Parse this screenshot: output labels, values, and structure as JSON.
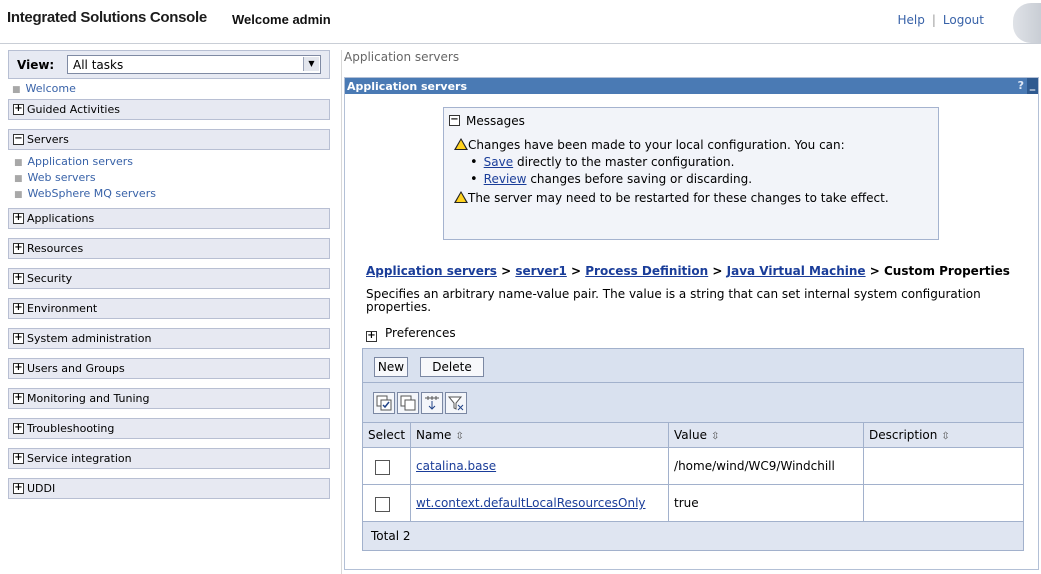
{
  "header": {
    "app_title": "Integrated Solutions Console",
    "welcome": "Welcome admin",
    "help": "Help",
    "logout": "Logout"
  },
  "nav": {
    "view_label": "View:",
    "view_value": "All tasks",
    "welcome": "Welcome",
    "groups": [
      {
        "label": "Guided Activities",
        "state": "+"
      },
      {
        "label": "Servers",
        "state": "−",
        "items": [
          "Application servers",
          "Web servers",
          "WebSphere MQ servers"
        ]
      },
      {
        "label": "Applications",
        "state": "+"
      },
      {
        "label": "Resources",
        "state": "+"
      },
      {
        "label": "Security",
        "state": "+"
      },
      {
        "label": "Environment",
        "state": "+"
      },
      {
        "label": "System administration",
        "state": "+"
      },
      {
        "label": "Users and Groups",
        "state": "+"
      },
      {
        "label": "Monitoring and Tuning",
        "state": "+"
      },
      {
        "label": "Troubleshooting",
        "state": "+"
      },
      {
        "label": "Service integration",
        "state": "+"
      },
      {
        "label": "UDDI",
        "state": "+"
      }
    ]
  },
  "main": {
    "page_heading": "Application servers",
    "panel_title": "Application servers",
    "panel_help": "?",
    "panel_minimize": "_",
    "messages": {
      "title": "Messages",
      "line1": "Changes have been made to your local configuration. You can:",
      "save_link": "Save",
      "save_rest": " directly to the master configuration.",
      "review_link": "Review",
      "review_rest": " changes before saving or discarding.",
      "line4": "The server may need to be restarted for these changes to take effect."
    },
    "breadcrumb": {
      "items": [
        "Application servers",
        "server1",
        "Process Definition",
        "Java Virtual Machine"
      ],
      "separator": " > ",
      "current": "Custom Properties"
    },
    "description": "Specifies an arbitrary name-value pair. The value is a string that can set internal system configuration properties.",
    "preferences": "Preferences",
    "buttons": {
      "new": "New",
      "delete": "Delete"
    },
    "table": {
      "headers": {
        "select": "Select",
        "name": "Name",
        "value": "Value",
        "description": "Description"
      },
      "sort_glyph": "⇳",
      "rows": [
        {
          "name": "catalina.base",
          "value": "/home/wind/WC9/Windchill",
          "description": ""
        },
        {
          "name": "wt.context.defaultLocalResourcesOnly",
          "value": "true",
          "description": ""
        }
      ],
      "total": "Total 2"
    }
  }
}
